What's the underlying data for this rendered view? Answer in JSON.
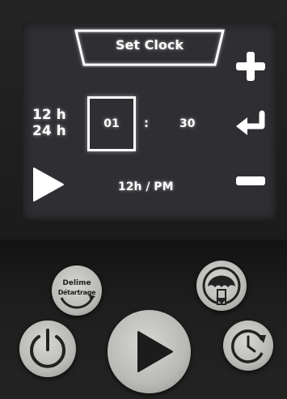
{
  "screen": {
    "title": "Set Clock",
    "format_12": "12 h",
    "format_24": "24 h",
    "hour_value": "01",
    "separator": ":",
    "minute_value": "30",
    "ampm_mode": "12h / PM",
    "icons": {
      "increase": "plus-icon",
      "confirm": "enter-icon",
      "decrease": "minus-icon",
      "next": "play-arrow-icon"
    }
  },
  "panel": {
    "delime_label_en": "Delime",
    "delime_label_fr": "Détartrage",
    "icons": {
      "hood": "hood-icon",
      "power": "power-icon",
      "start": "play-icon",
      "timer": "clock-refresh-icon"
    }
  },
  "colors": {
    "screen_bg": "#2f2f33",
    "glow": "#ffffff",
    "knob": "#c8c8c4",
    "panel": "#1e1e1e"
  }
}
